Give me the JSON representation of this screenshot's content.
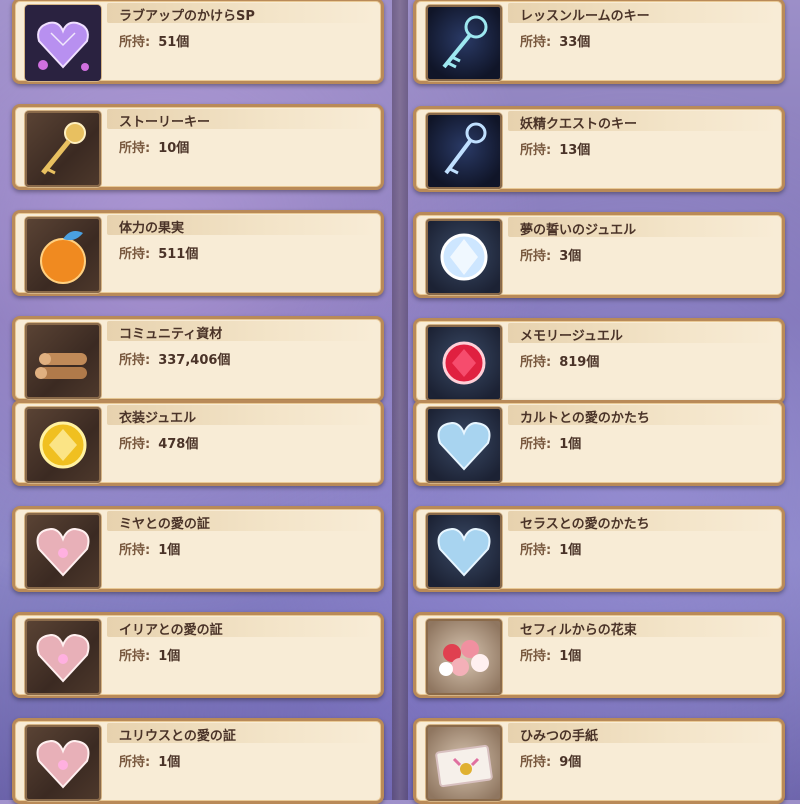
{
  "items": [
    {
      "name": "ラブアップのかけらSP",
      "label": "所持:",
      "count": "51個",
      "icon": "purple-gem-heart-icon"
    },
    {
      "name": "レッスンルームのキー",
      "label": "所持:",
      "count": "33個",
      "icon": "blue-star-key-icon"
    },
    {
      "name": "ストーリーキー",
      "label": "所持:",
      "count": "10個",
      "icon": "gold-key-icon"
    },
    {
      "name": "妖精クエストのキー",
      "label": "所持:",
      "count": "13個",
      "icon": "fairy-key-icon"
    },
    {
      "name": "体力の果実",
      "label": "所持:",
      "count": "511個",
      "icon": "golden-apple-icon"
    },
    {
      "name": "夢の誓いのジュエル",
      "label": "所持:",
      "count": "3個",
      "icon": "white-diamond-icon"
    },
    {
      "name": "コミュニティ資材",
      "label": "所持:",
      "count": "337,406個",
      "icon": "wood-logs-icon"
    },
    {
      "name": "メモリージュエル",
      "label": "所持:",
      "count": "819個",
      "icon": "red-jewel-icon"
    },
    {
      "name": "衣装ジュエル",
      "label": "所持:",
      "count": "478個",
      "icon": "yellow-jewel-icon"
    },
    {
      "name": "カルトとの愛のかたち",
      "label": "所持:",
      "count": "1個",
      "icon": "blue-heart-icon"
    },
    {
      "name": "ミヤとの愛の証",
      "label": "所持:",
      "count": "1個",
      "icon": "pink-heart-icon"
    },
    {
      "name": "セラスとの愛のかたち",
      "label": "所持:",
      "count": "1個",
      "icon": "blue-heart-icon"
    },
    {
      "name": "イリアとの愛の証",
      "label": "所持:",
      "count": "1個",
      "icon": "pink-heart-icon"
    },
    {
      "name": "セフィルからの花束",
      "label": "所持:",
      "count": "1個",
      "icon": "flower-bouquet-icon"
    },
    {
      "name": "ユリウスとの愛の証",
      "label": "所持:",
      "count": "1個",
      "icon": "pink-heart-icon"
    },
    {
      "name": "ひみつの手紙",
      "label": "所持:",
      "count": "9個",
      "icon": "secret-letter-icon"
    }
  ]
}
